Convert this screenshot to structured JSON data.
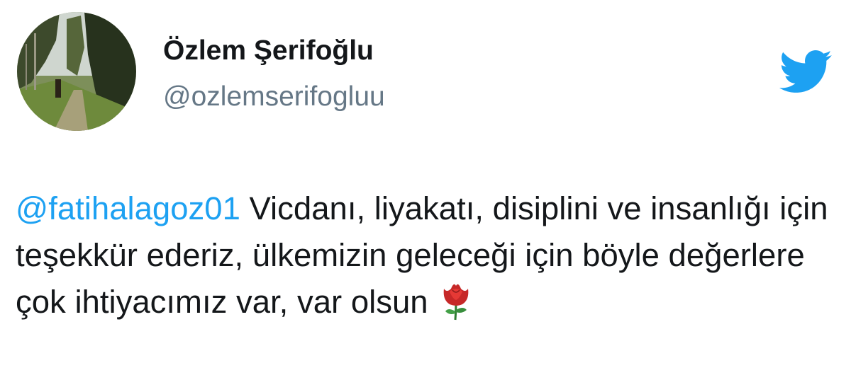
{
  "author": {
    "display_name": "Özlem Şerifoğlu",
    "handle": "@ozlemserifogluu",
    "avatar": "avatar-photo-forest-path"
  },
  "brand": {
    "icon": "twitter-bird-icon",
    "color": "#1da1f2"
  },
  "tweet": {
    "mention": "@fatihalagoz01",
    "text": " Vicdanı, liyakatı, disiplini ve insanlığı için teşekkür ederiz, ülkemizin geleceği için böyle değerlere çok ihtiyacımız var, var olsun",
    "emoji": "rose-emoji"
  },
  "colors": {
    "text": "#14171a",
    "secondary": "#657786",
    "link": "#1da1f2"
  }
}
